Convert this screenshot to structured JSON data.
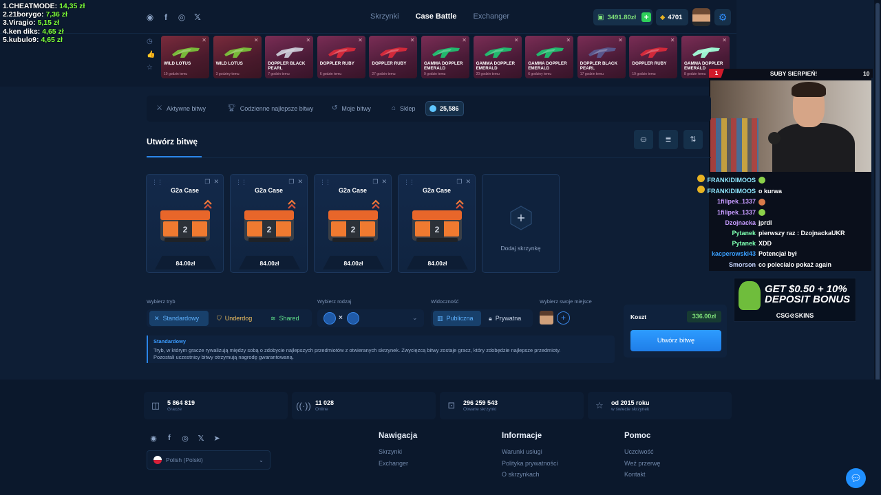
{
  "leaderboard": [
    {
      "name": "1.CHEATMODE:",
      "value": "14,35 zł"
    },
    {
      "name": "2.21borygo:",
      "value": "7,36 zł"
    },
    {
      "name": "3.Viragio:",
      "value": "5,15 zł"
    },
    {
      "name": "4.ken diks:",
      "value": "4,65 zł"
    },
    {
      "name": "5.kubulo9:",
      "value": "4,65 zł"
    }
  ],
  "header": {
    "nav": [
      "Skrzynki",
      "Case Battle",
      "Exchanger"
    ],
    "active_nav": "Case Battle",
    "balance": "3491.80zł",
    "coins": "4701"
  },
  "drops": [
    {
      "name": "WILD LOTUS",
      "time": "10 godzin temu",
      "tone": "red"
    },
    {
      "name": "WILD LOTUS",
      "time": "3 godziny temu",
      "tone": "red"
    },
    {
      "name": "DOPPLER BLACK PEARL",
      "time": "7 godzin temu",
      "tone": "pink"
    },
    {
      "name": "DOPPLER RUBY",
      "time": "6 godzin temu",
      "tone": "pink"
    },
    {
      "name": "DOPPLER RUBY",
      "time": "27 godzin temu",
      "tone": "pink"
    },
    {
      "name": "GAMMA DOPPLER EMERALD",
      "time": "9 godzin temu",
      "tone": "pink"
    },
    {
      "name": "GAMMA DOPPLER EMERALD",
      "time": "20 godzin temu",
      "tone": "pink"
    },
    {
      "name": "GAMMA DOPPLER EMERALD",
      "time": "6 godziny temu",
      "tone": "pink"
    },
    {
      "name": "DOPPLER BLACK PEARL",
      "time": "17 godzin temu",
      "tone": "pink"
    },
    {
      "name": "DOPPLER RUBY",
      "time": "19 godzin temu",
      "tone": "pink"
    },
    {
      "name": "GAMMA DOPPLER EMERALD",
      "time": "8 godzin temu",
      "tone": "pink"
    }
  ],
  "stream": {
    "sub_count": "1",
    "sub_title": "SUBY SIERPIEŃ!",
    "sub_goal": "10",
    "chat": [
      {
        "user": "FRANKIDIMOOS",
        "msg": "",
        "color": "#8fe8ff",
        "badge": true,
        "emote": "green"
      },
      {
        "user": "FRANKIDIMOOS",
        "msg": "o kurwa",
        "color": "#8fe8ff",
        "badge": true,
        "emote": ""
      },
      {
        "user": "1filipek_1337",
        "msg": "",
        "color": "#c79cff",
        "badge": false,
        "emote": "red"
      },
      {
        "user": "1filipek_1337",
        "msg": "",
        "color": "#c79cff",
        "badge": false,
        "emote": "green"
      },
      {
        "user": "Dzojnacka",
        "msg": "jprdl",
        "color": "#c79cff",
        "badge": false,
        "emote": ""
      },
      {
        "user": "Pytanek",
        "msg": "pierwszy raz : DzojnackaUKR",
        "color": "#7dffb0",
        "badge": false,
        "emote": ""
      },
      {
        "user": "Pytanek",
        "msg": "XDD",
        "color": "#7dffb0",
        "badge": false,
        "emote": ""
      },
      {
        "user": "kacperowski43",
        "msg": "Potencjał był",
        "color": "#3aa0ff",
        "badge": false,
        "emote": ""
      },
      {
        "user": "Smorson",
        "msg": "co polecialo pokaż again",
        "color": "#c8d6ff",
        "badge": false,
        "emote": ""
      }
    ],
    "ad_line1": "GET $0.50 + 10%",
    "ad_line2": "DEPOSIT BONUS",
    "ad_brand": "CSG⊘SKINS"
  },
  "tabs": [
    {
      "label": "Aktywne bitwy",
      "icon": "swords-icon"
    },
    {
      "label": "Codzienne najlepsze bitwy",
      "icon": "trophy-icon"
    },
    {
      "label": "Moje bitwy",
      "icon": "history-icon"
    },
    {
      "label": "Sklep",
      "icon": "shop-icon"
    }
  ],
  "gems": "25,586",
  "create": {
    "title": "Utwórz bitwę",
    "cases": [
      {
        "name": "G2a Case",
        "price": "84.00zł"
      },
      {
        "name": "G2a Case",
        "price": "84.00zł"
      },
      {
        "name": "G2a Case",
        "price": "84.00zł"
      },
      {
        "name": "G2a Case",
        "price": "84.00zł"
      }
    ],
    "add_case": "Dodaj skrzynkę"
  },
  "options": {
    "mode_label": "Wybierz tryb",
    "modes": [
      "Standardowy",
      "Underdog",
      "Shared"
    ],
    "kind_label": "Wybierz rodzaj",
    "kind_vs": "×",
    "visibility_label": "Widoczność",
    "visibility": [
      "Publiczna",
      "Prywatna"
    ],
    "seat_label": "Wybierz swoje miejsce"
  },
  "info": {
    "heading": "Standardowy",
    "line1": "Tryb, w którym gracze rywalizują między sobą o zdobycie najlepszych przedmiotów z otwieranych skrzynek. Zwycięzcą bitwy zostaje gracz, który zdobędzie najlepsze przedmioty.",
    "line2": "Pozostali uczestnicy bitwy otrzymują nagrodę gwarantowaną."
  },
  "cost": {
    "label": "Koszt",
    "value": "336.00zł",
    "button": "Utwórz bitwę"
  },
  "stats": [
    {
      "value": "5 864 819",
      "label": "Gracze",
      "icon": "users-icon"
    },
    {
      "value": "11 028",
      "label": "Online",
      "icon": "signal-icon"
    },
    {
      "value": "296 259 543",
      "label": "Otwarte skrzynki",
      "icon": "box-icon"
    },
    {
      "value": "od 2015 roku",
      "label": "w świecie skrzynek",
      "icon": "star-icon"
    }
  ],
  "footer": {
    "language": "Polish (Polski)",
    "columns": [
      {
        "title": "Nawigacja",
        "links": [
          "Skrzynki",
          "Exchanger"
        ]
      },
      {
        "title": "Informacje",
        "links": [
          "Warunki usługi",
          "Polityka prywatności",
          "O skrzynkach"
        ]
      },
      {
        "title": "Pomoc",
        "links": [
          "Uczciwość",
          "Weź przerwę",
          "Kontakt"
        ]
      }
    ]
  },
  "colors": {
    "accent": "#2a85e8",
    "success": "#7fe07a",
    "bg": "#0e1e35"
  }
}
